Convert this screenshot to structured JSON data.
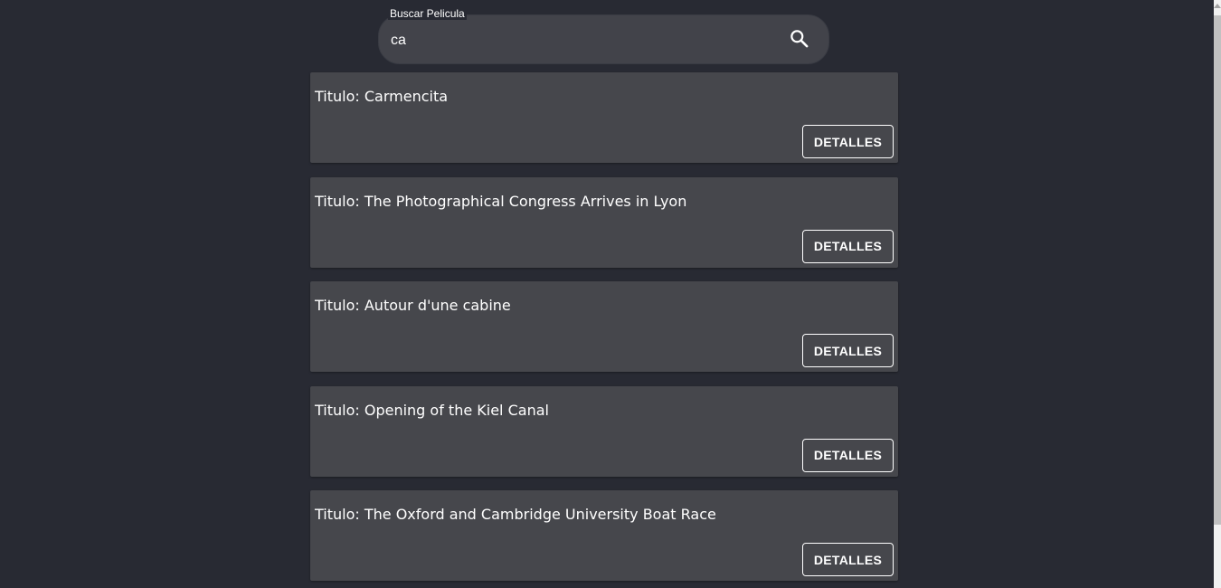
{
  "search": {
    "label": "Buscar Pelicula",
    "value": "ca",
    "icon": "search-icon"
  },
  "results": [
    {
      "prefix": "Titulo: ",
      "title": "Carmencita",
      "button": "DETALLES"
    },
    {
      "prefix": "Titulo: ",
      "title": "The Photographical Congress Arrives in Lyon",
      "button": "DETALLES"
    },
    {
      "prefix": "Titulo: ",
      "title": "Autour d'une cabine",
      "button": "DETALLES"
    },
    {
      "prefix": "Titulo: ",
      "title": "Opening of the Kiel Canal",
      "button": "DETALLES"
    },
    {
      "prefix": "Titulo: ",
      "title": "The Oxford and Cambridge University Boat Race",
      "button": "DETALLES"
    }
  ],
  "colors": {
    "background": "#282a33",
    "card": "#46474c",
    "text": "#ffffff"
  }
}
